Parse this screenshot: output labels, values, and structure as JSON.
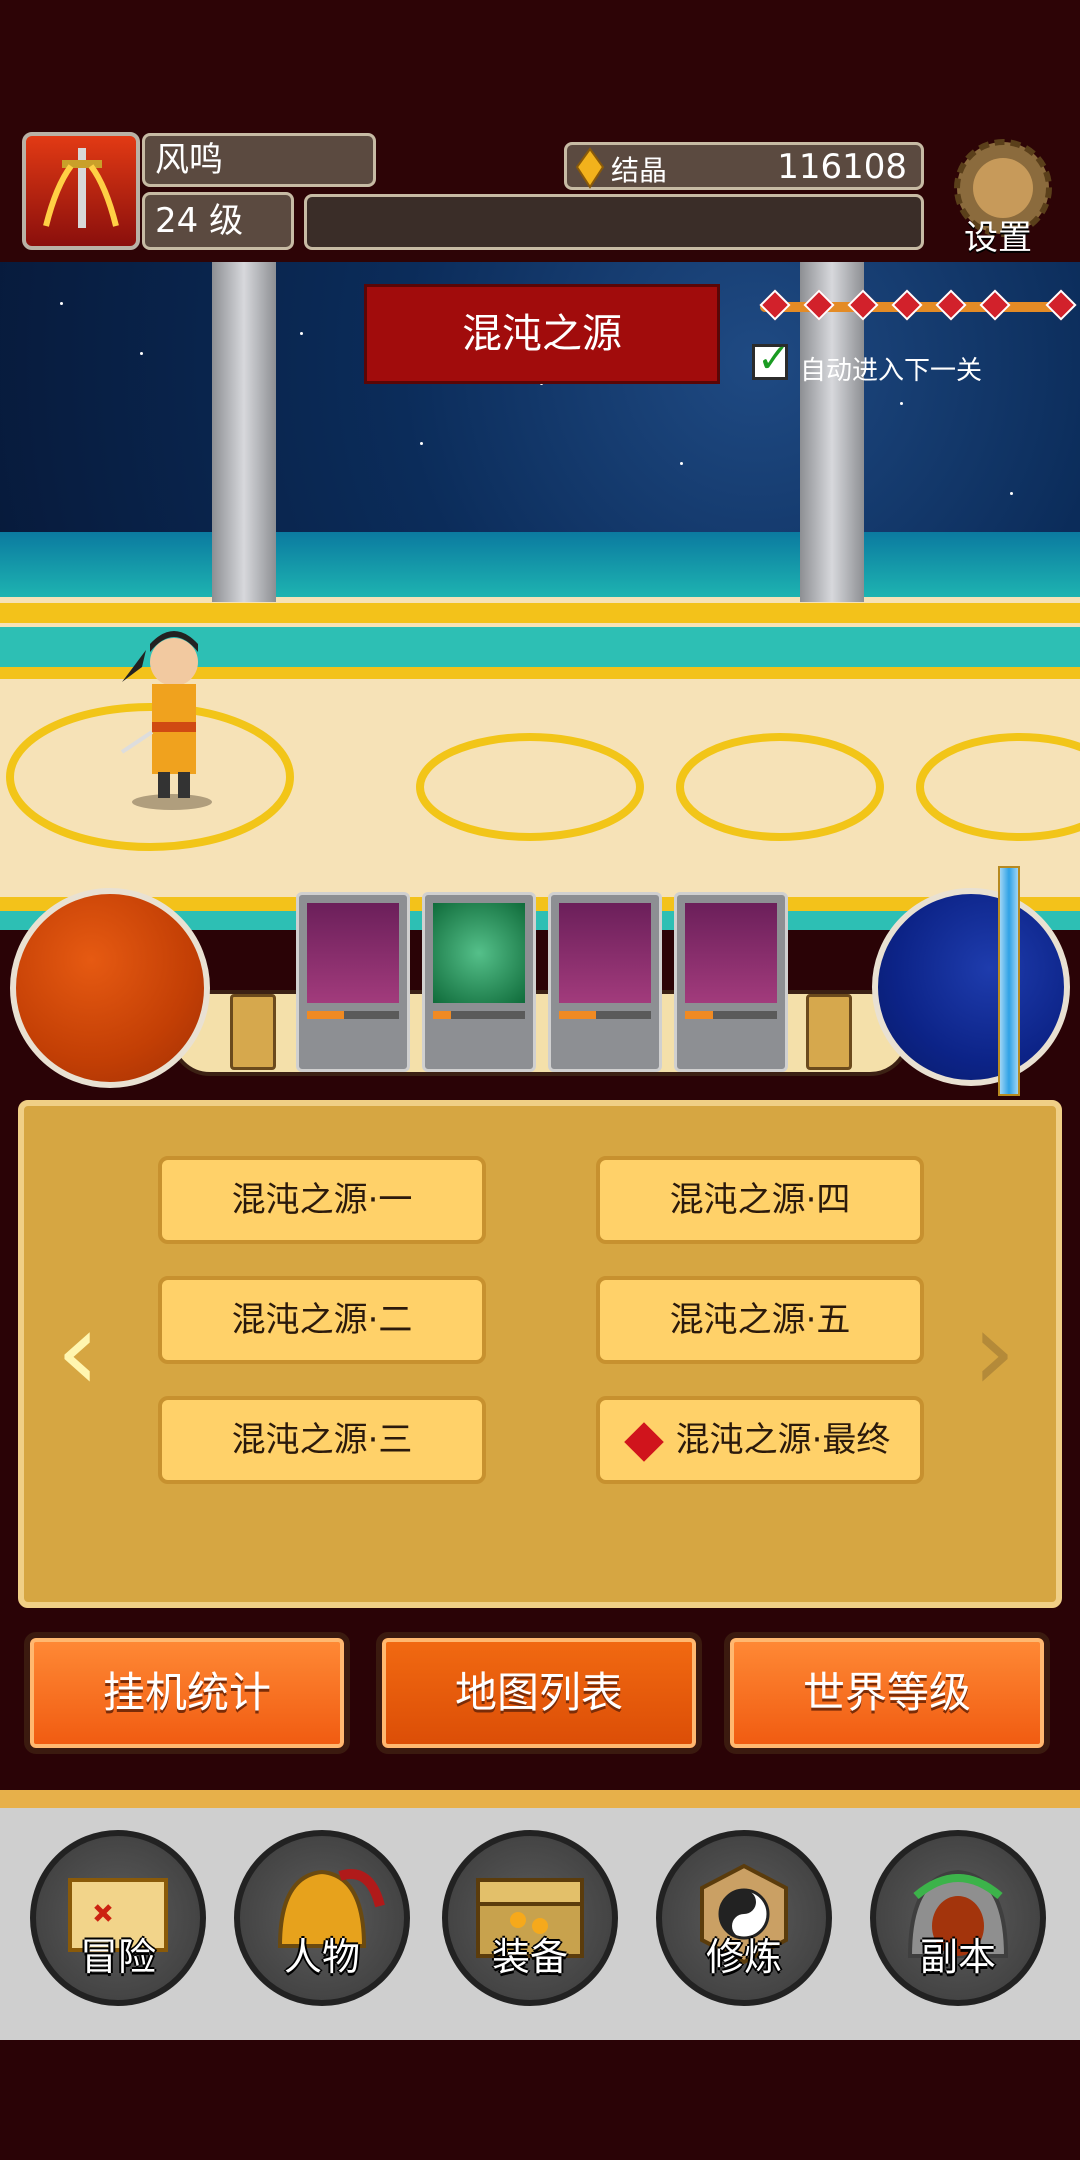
{
  "player": {
    "name": "风鸣",
    "level": "24 级",
    "crystal_label": "结晶",
    "crystal_value": "116108"
  },
  "settings_label": "设置",
  "stage": {
    "title": "混沌之源",
    "auto_next_label": "自动进入下一关",
    "auto_next_checked": true,
    "progress_markers": 7
  },
  "map_list": {
    "items": [
      "混沌之源·一",
      "混沌之源·二",
      "混沌之源·三",
      "混沌之源·四",
      "混沌之源·五",
      "混沌之源·最终"
    ]
  },
  "tabs": [
    "挂机统计",
    "地图列表",
    "世界等级"
  ],
  "active_tab": "地图列表",
  "nav": [
    "冒险",
    "人物",
    "装备",
    "修炼",
    "副本"
  ],
  "colors": {
    "hp_orb": "#c33f05",
    "mp_orb": "#0c2387",
    "parchment": "#d6a642",
    "tab_orange": "#f05a10"
  },
  "skill_cooldowns": [
    0.4,
    0.2,
    0.4,
    0.3
  ]
}
